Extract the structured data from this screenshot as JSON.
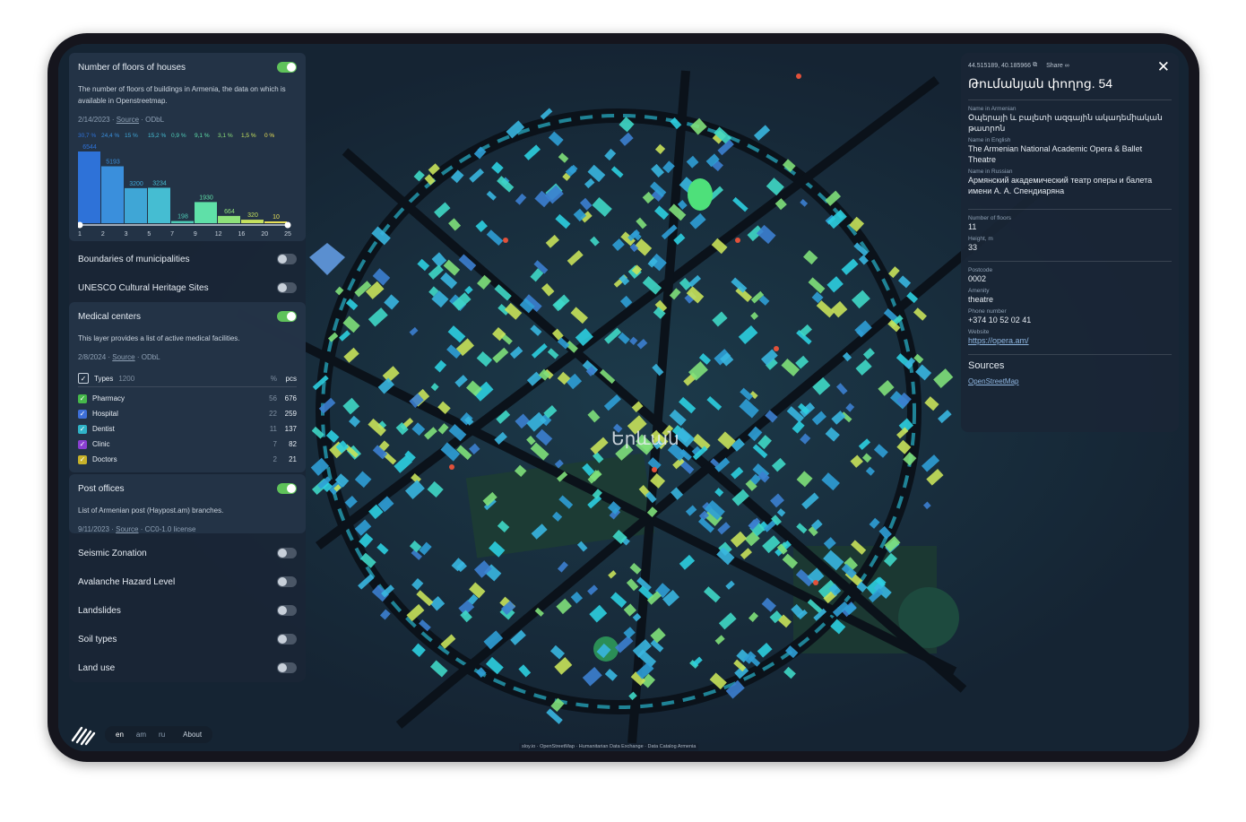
{
  "layers": [
    {
      "title": "Number of floors of houses",
      "on": true,
      "description": "The number of floors of buildings in Armenia, the data on which is available in Openstreetmap.",
      "date": "2/14/2023",
      "source_label": "Source",
      "license": "ODbL"
    },
    {
      "title": "Boundaries of municipalities",
      "on": false
    },
    {
      "title": "UNESCO Cultural Heritage Sites",
      "on": false
    },
    {
      "title": "Medical centers",
      "on": true,
      "description": "This layer provides a list of active medical facilities.",
      "date": "2/8/2024",
      "source_label": "Source",
      "license": "ODbL"
    },
    {
      "title": "Post offices",
      "on": true,
      "description": "List of Armenian post (Haypost.am) branches.",
      "date": "9/11/2023",
      "source_label": "Source",
      "license": "CC0-1.0 license"
    },
    {
      "title": "Seismic Zonation",
      "on": false
    },
    {
      "title": "Avalanche Hazard Level",
      "on": false
    },
    {
      "title": "Landslides",
      "on": false
    },
    {
      "title": "Soil types",
      "on": false
    },
    {
      "title": "Land use",
      "on": false
    }
  ],
  "floors_percentages": [
    "30,7 %",
    "24,4 %",
    "15 %",
    "15,2 %",
    "0,9 %",
    "9,1 %",
    "3,1 %",
    "1,5 %",
    "0 %"
  ],
  "chart_data": {
    "type": "bar",
    "categories": [
      "1",
      "2",
      "3",
      "5",
      "7",
      "9",
      "12",
      "16",
      "20",
      "25"
    ],
    "values": [
      6544,
      5193,
      3200,
      3234,
      198,
      1930,
      664,
      320,
      10
    ],
    "bar_colors": [
      "#2e72d8",
      "#3a8fdc",
      "#3fa6d6",
      "#45bdd2",
      "#4fcdb8",
      "#5fe0a8",
      "#8ee27a",
      "#c6e25e",
      "#e8e058"
    ],
    "range": [
      1,
      25
    ]
  },
  "medical": {
    "types_label": "Types",
    "types_total": "1200",
    "pct_label": "%",
    "count_label": "pcs",
    "rows": [
      {
        "name": "Pharmacy",
        "pct": "56",
        "count": "676",
        "color": "#46b84a"
      },
      {
        "name": "Hospital",
        "pct": "22",
        "count": "259",
        "color": "#3d6fd8"
      },
      {
        "name": "Dentist",
        "pct": "11",
        "count": "137",
        "color": "#2fb3c7"
      },
      {
        "name": "Clinic",
        "pct": "7",
        "count": "82",
        "color": "#8a3fd1"
      },
      {
        "name": "Doctors",
        "pct": "2",
        "count": "21",
        "color": "#c7b22a"
      }
    ]
  },
  "info": {
    "coords": "44.515189, 40.185966",
    "copy_icon": "copy-icon",
    "share_label": "Share",
    "title": "Թումանյան փողոց. 54",
    "fields_group1": [
      {
        "label": "Name in Armenian",
        "value": "Օպերայի և բալետի ազգային ակադեմիական թատրոն"
      },
      {
        "label": "Name in English",
        "value": "The Armenian National Academic Opera & Ballet Theatre"
      },
      {
        "label": "Name in Russian",
        "value": "Армянский академический театр оперы и балета имени А. А. Спендиаряна"
      }
    ],
    "fields_group2": [
      {
        "label": "Number of floors",
        "value": "11"
      },
      {
        "label": "Height, m",
        "value": "33"
      }
    ],
    "fields_group3": [
      {
        "label": "Postcode",
        "value": "0002"
      },
      {
        "label": "Amenity",
        "value": "theatre"
      },
      {
        "label": "Phone number",
        "value": "+374 10 52 02 41"
      },
      {
        "label": "Website",
        "value": "https://opera.am/"
      }
    ],
    "sources_title": "Sources",
    "sources_link": "OpenStreetMap"
  },
  "map": {
    "city_label": "Երևան",
    "attribution": "sloy.io · OpenStreetMap · Humanitarian Data Exchange · Data Catalog Armenia"
  },
  "footer": {
    "languages": [
      "en",
      "am",
      "ru"
    ],
    "active_language": "en",
    "about_label": "About"
  }
}
